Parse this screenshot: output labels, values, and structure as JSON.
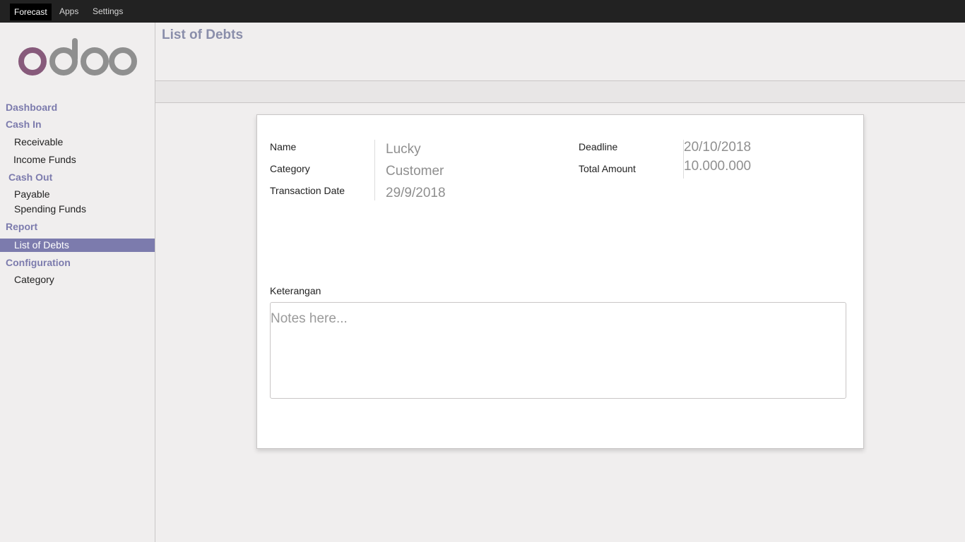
{
  "topbar": {
    "menus": [
      "Forecast",
      "Apps",
      "Settings"
    ],
    "active": "Forecast"
  },
  "brand": {
    "logo_text": "odoo",
    "colors": {
      "o_first": "#875a7b",
      "rest": "#8f8f8f"
    }
  },
  "sidebar": {
    "sections": [
      {
        "label": "Dashboard"
      },
      {
        "label": "Cash In",
        "items": [
          "Receivable",
          "Income Funds"
        ]
      },
      {
        "label": "Cash Out",
        "items": [
          "Payable",
          "Spending Funds"
        ]
      },
      {
        "label": "Report",
        "items": [
          "List of Debts"
        ]
      },
      {
        "label": "Configuration",
        "items": [
          "Category"
        ]
      }
    ],
    "active_item": "List of Debts"
  },
  "page": {
    "title": "List of Debts"
  },
  "form": {
    "name_label": "Name",
    "name_value": "Lucky",
    "category_label": "Category",
    "category_value": "Customer",
    "transaction_date_label": "Transaction Date",
    "transaction_date_value": "29/9/2018",
    "deadline_label": "Deadline",
    "deadline_value": "20/10/2018",
    "total_amount_label": "Total Amount",
    "total_amount_value": "10.000.000",
    "notes_label": "Keterangan",
    "notes_placeholder": "Notes here..."
  },
  "colors": {
    "accent": "#7c7bad",
    "topbar": "#222222",
    "background": "#f0eeee"
  }
}
